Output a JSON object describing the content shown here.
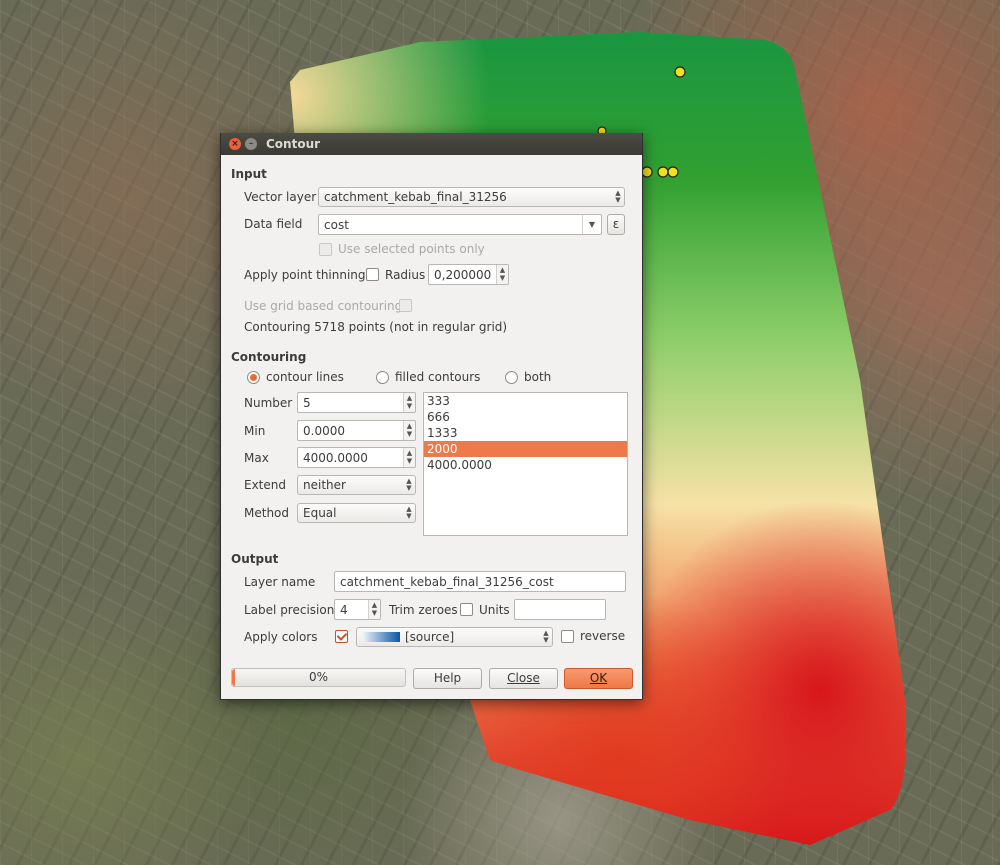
{
  "window": {
    "title": "Contour"
  },
  "map": {
    "ramp_colors": [
      "#d8191a",
      "#f07a4a",
      "#f6e2a6",
      "#8fce6a",
      "#31a031",
      "#1a9641"
    ]
  },
  "input": {
    "heading": "Input",
    "vector_layer_label": "Vector layer",
    "vector_layer_value": "catchment_kebab_final_31256",
    "data_field_label": "Data field",
    "data_field_value": "cost",
    "expression_icon": "ε",
    "use_selected_label": "Use selected points only",
    "point_thinning_label": "Apply point thinning",
    "radius_label": "Radius",
    "radius_value": "0,200000",
    "grid_contouring_label": "Use grid based contouring",
    "contouring_info": "Contouring 5718 points (not in regular grid)"
  },
  "contouring": {
    "heading": "Contouring",
    "modes": [
      "contour lines",
      "filled contours",
      "both"
    ],
    "selected_mode": "contour lines",
    "number_label": "Number",
    "number_value": "5",
    "min_label": "Min",
    "min_value": "0.0000",
    "max_label": "Max",
    "max_value": "4000.0000",
    "extend_label": "Extend",
    "extend_value": "neither",
    "method_label": "Method",
    "method_value": "Equal",
    "levels": [
      "333",
      "666",
      "1333",
      "2000",
      "4000.0000"
    ],
    "selected_level": "2000"
  },
  "output": {
    "heading": "Output",
    "layer_name_label": "Layer name",
    "layer_name_value": "catchment_kebab_final_31256_cost",
    "label_precision_label": "Label precision",
    "label_precision_value": "4",
    "trim_zeroes_label": "Trim zeroes",
    "units_label": "Units",
    "units_value": "",
    "apply_colors_label": "Apply colors",
    "color_ramp_value": "[source]",
    "reverse_label": "reverse"
  },
  "footer": {
    "progress_text": "0%",
    "progress_value": 0,
    "help_label": "Help",
    "close_label": "Close",
    "ok_label": "OK"
  }
}
